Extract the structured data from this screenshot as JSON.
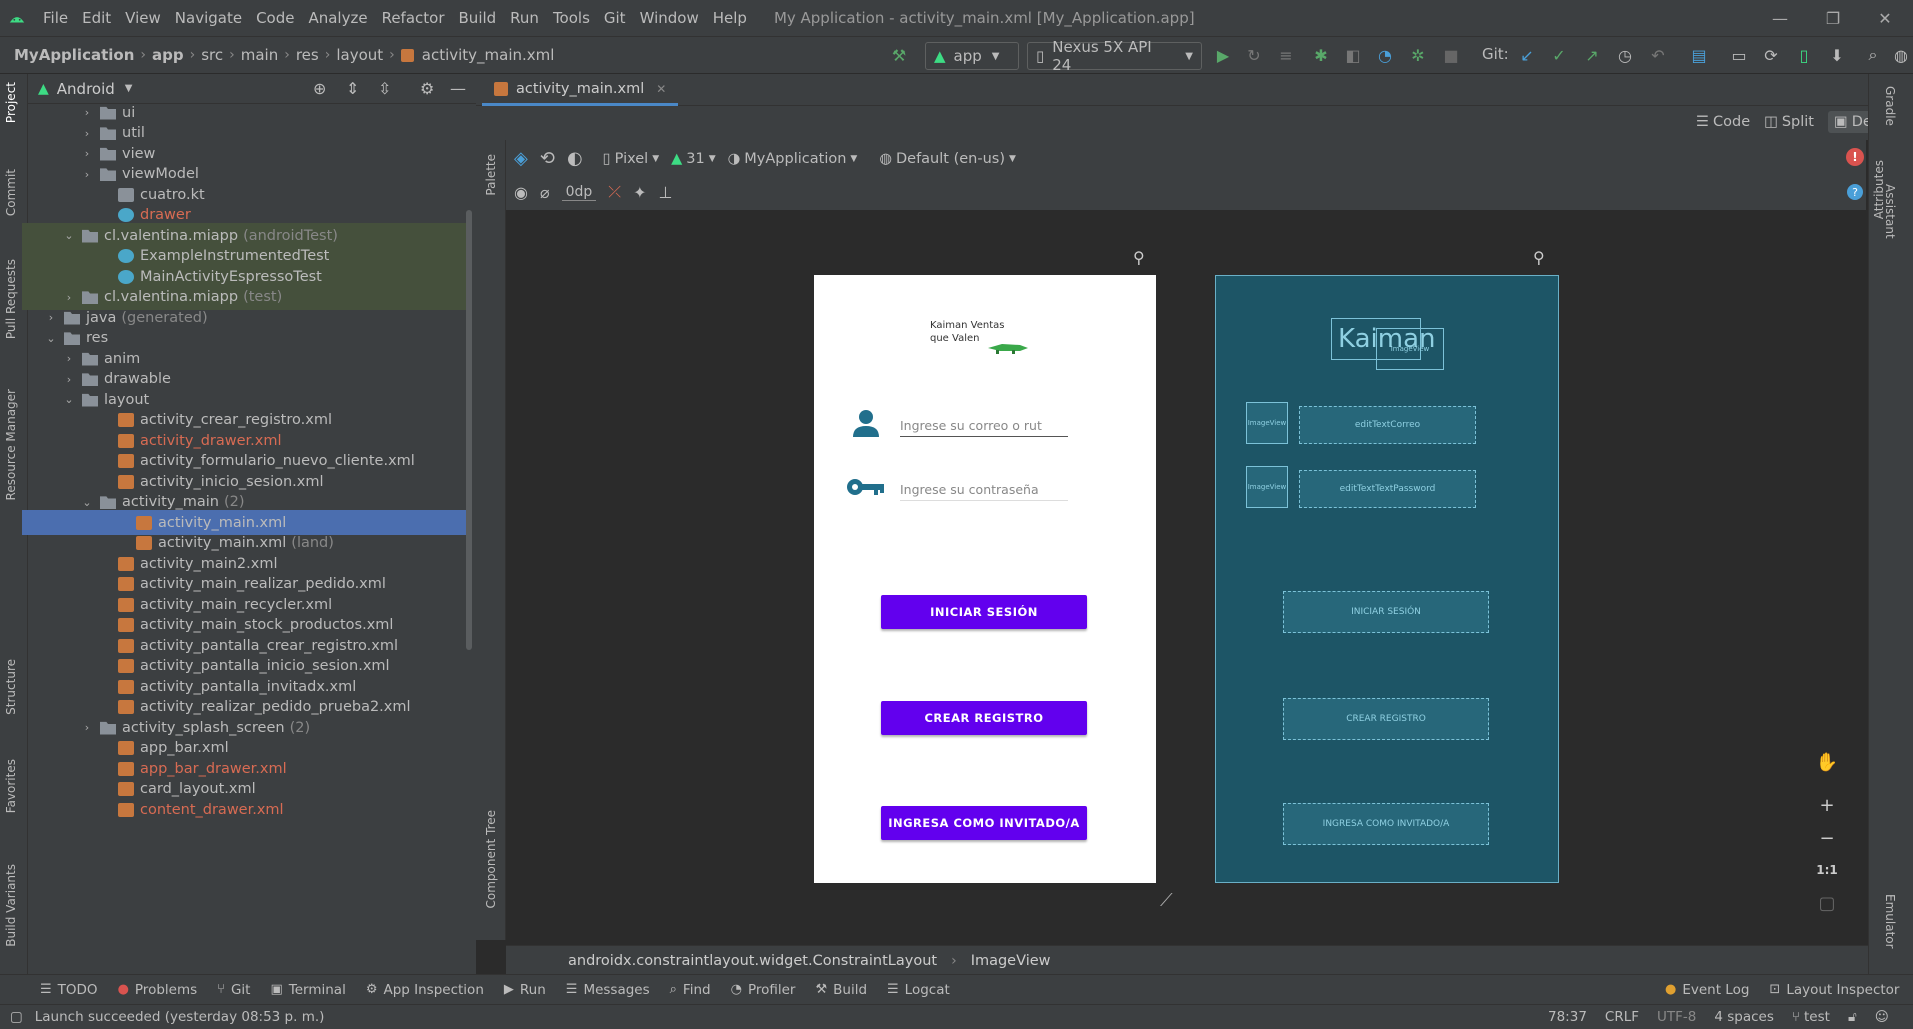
{
  "menu": [
    "File",
    "Edit",
    "View",
    "Navigate",
    "Code",
    "Analyze",
    "Refactor",
    "Build",
    "Run",
    "Tools",
    "Git",
    "Window",
    "Help"
  ],
  "window_title": "My Application - activity_main.xml [My_Application.app]",
  "breadcrumb": [
    "MyApplication",
    "app",
    "src",
    "main",
    "res",
    "layout",
    "activity_main.xml"
  ],
  "run_config": "app",
  "device": "Nexus 5X API 24",
  "git_label": "Git:",
  "project_view": "Android",
  "left_tabs": [
    "Project",
    "Commit",
    "Pull Requests",
    "Resource Manager",
    "Structure",
    "Favorites",
    "Build Variants"
  ],
  "tree": [
    {
      "label": "ui",
      "depth": 3,
      "arrow": ">",
      "icon": "folder"
    },
    {
      "label": "util",
      "depth": 3,
      "arrow": ">",
      "icon": "folder"
    },
    {
      "label": "view",
      "depth": 3,
      "arrow": ">",
      "icon": "folder"
    },
    {
      "label": "viewModel",
      "depth": 3,
      "arrow": ">",
      "icon": "folder"
    },
    {
      "label": "cuatro.kt",
      "depth": 4,
      "arrow": "",
      "icon": "kt"
    },
    {
      "label": "drawer",
      "depth": 4,
      "arrow": "",
      "icon": "test",
      "red": true
    },
    {
      "label": "cl.valentina.miapp",
      "extra": "(androidTest)",
      "depth": 2,
      "arrow": "v",
      "icon": "folder",
      "hl": true
    },
    {
      "label": "ExampleInstrumentedTest",
      "depth": 4,
      "arrow": "",
      "icon": "test",
      "hl": true
    },
    {
      "label": "MainActivityEspressoTest",
      "depth": 4,
      "arrow": "",
      "icon": "test",
      "hl": true
    },
    {
      "label": "cl.valentina.miapp",
      "extra": "(test)",
      "depth": 2,
      "arrow": ">",
      "icon": "folder",
      "hl": true
    },
    {
      "label": "java",
      "extra": "(generated)",
      "depth": 1,
      "arrow": ">",
      "icon": "folder"
    },
    {
      "label": "res",
      "depth": 1,
      "arrow": "v",
      "icon": "folder"
    },
    {
      "label": "anim",
      "depth": 2,
      "arrow": ">",
      "icon": "folder"
    },
    {
      "label": "drawable",
      "depth": 2,
      "arrow": ">",
      "icon": "folder"
    },
    {
      "label": "layout",
      "depth": 2,
      "arrow": "v",
      "icon": "folder"
    },
    {
      "label": "activity_crear_registro.xml",
      "depth": 4,
      "arrow": "",
      "icon": "xml"
    },
    {
      "label": "activity_drawer.xml",
      "depth": 4,
      "arrow": "",
      "icon": "xml",
      "red": true
    },
    {
      "label": "activity_formulario_nuevo_cliente.xml",
      "depth": 4,
      "arrow": "",
      "icon": "xml"
    },
    {
      "label": "activity_inicio_sesion.xml",
      "depth": 4,
      "arrow": "",
      "icon": "xml"
    },
    {
      "label": "activity_main",
      "extra": "(2)",
      "depth": 3,
      "arrow": "v",
      "icon": "folder"
    },
    {
      "label": "activity_main.xml",
      "depth": 5,
      "arrow": "",
      "icon": "xml",
      "sel": true
    },
    {
      "label": "activity_main.xml",
      "extra": "(land)",
      "depth": 5,
      "arrow": "",
      "icon": "xml"
    },
    {
      "label": "activity_main2.xml",
      "depth": 4,
      "arrow": "",
      "icon": "xml"
    },
    {
      "label": "activity_main_realizar_pedido.xml",
      "depth": 4,
      "arrow": "",
      "icon": "xml"
    },
    {
      "label": "activity_main_recycler.xml",
      "depth": 4,
      "arrow": "",
      "icon": "xml"
    },
    {
      "label": "activity_main_stock_productos.xml",
      "depth": 4,
      "arrow": "",
      "icon": "xml"
    },
    {
      "label": "activity_pantalla_crear_registro.xml",
      "depth": 4,
      "arrow": "",
      "icon": "xml"
    },
    {
      "label": "activity_pantalla_inicio_sesion.xml",
      "depth": 4,
      "arrow": "",
      "icon": "xml"
    },
    {
      "label": "activity_pantalla_invitadx.xml",
      "depth": 4,
      "arrow": "",
      "icon": "xml"
    },
    {
      "label": "activity_realizar_pedido_prueba2.xml",
      "depth": 4,
      "arrow": "",
      "icon": "xml"
    },
    {
      "label": "activity_splash_screen",
      "extra": "(2)",
      "depth": 3,
      "arrow": ">",
      "icon": "folder"
    },
    {
      "label": "app_bar.xml",
      "depth": 4,
      "arrow": "",
      "icon": "xml"
    },
    {
      "label": "app_bar_drawer.xml",
      "depth": 4,
      "arrow": "",
      "icon": "xml",
      "red": true
    },
    {
      "label": "card_layout.xml",
      "depth": 4,
      "arrow": "",
      "icon": "xml"
    },
    {
      "label": "content_drawer.xml",
      "depth": 4,
      "arrow": "",
      "icon": "xml",
      "red": true
    }
  ],
  "editor_tab": "activity_main.xml",
  "view_modes": {
    "code": "Code",
    "split": "Split",
    "design": "Design"
  },
  "design_toolbar": {
    "device": "Pixel",
    "api": "31",
    "theme": "MyApplication",
    "locale": "Default (en-us)",
    "margin": "0dp"
  },
  "side_labels": {
    "palette": "Palette",
    "component_tree": "Component Tree",
    "attributes": "Attributes",
    "gradle": "Gradle",
    "assistant": "Assistant",
    "emulator": "Emulator"
  },
  "phone": {
    "logo_line1": "Kaiman Ventas",
    "logo_line2": "que Valen",
    "email_hint": "Ingrese su correo o rut",
    "password_hint": "Ingrese su contraseña",
    "btn_login": "INICIAR SESIÓN",
    "btn_register": "CREAR REGISTRO",
    "btn_guest": "INGRESA COMO INVITADO/A"
  },
  "blueprint": {
    "logo_text": "Kaiman",
    "image_label": "ImageView",
    "edit_email": "editTextCorreo",
    "edit_password": "editTextTextPassword",
    "btn_login": "INICIAR SESIÓN",
    "btn_register": "CREAR REGISTRO",
    "btn_guest": "INGRESA COMO INVITADO/A"
  },
  "zoom": {
    "fit": "1:1"
  },
  "component_path": [
    "androidx.constraintlayout.widget.ConstraintLayout",
    "ImageView"
  ],
  "bottom_tabs": [
    "TODO",
    "Problems",
    "Git",
    "Terminal",
    "App Inspection",
    "Run",
    "Messages",
    "Find",
    "Profiler",
    "Build",
    "Logcat"
  ],
  "bottom_right_tabs": [
    "Event Log",
    "Layout Inspector"
  ],
  "status": {
    "message": "Launch succeeded (yesterday 08:53 p. m.)",
    "position": "78:37",
    "line_sep": "CRLF",
    "encoding": "UTF-8",
    "indent": "4 spaces",
    "branch": "test"
  },
  "colors": {
    "accent_button": "#6200ee",
    "blueprint_bg": "#1d5566",
    "selection": "#4b6eaf",
    "android_green": "#3ddc84"
  }
}
